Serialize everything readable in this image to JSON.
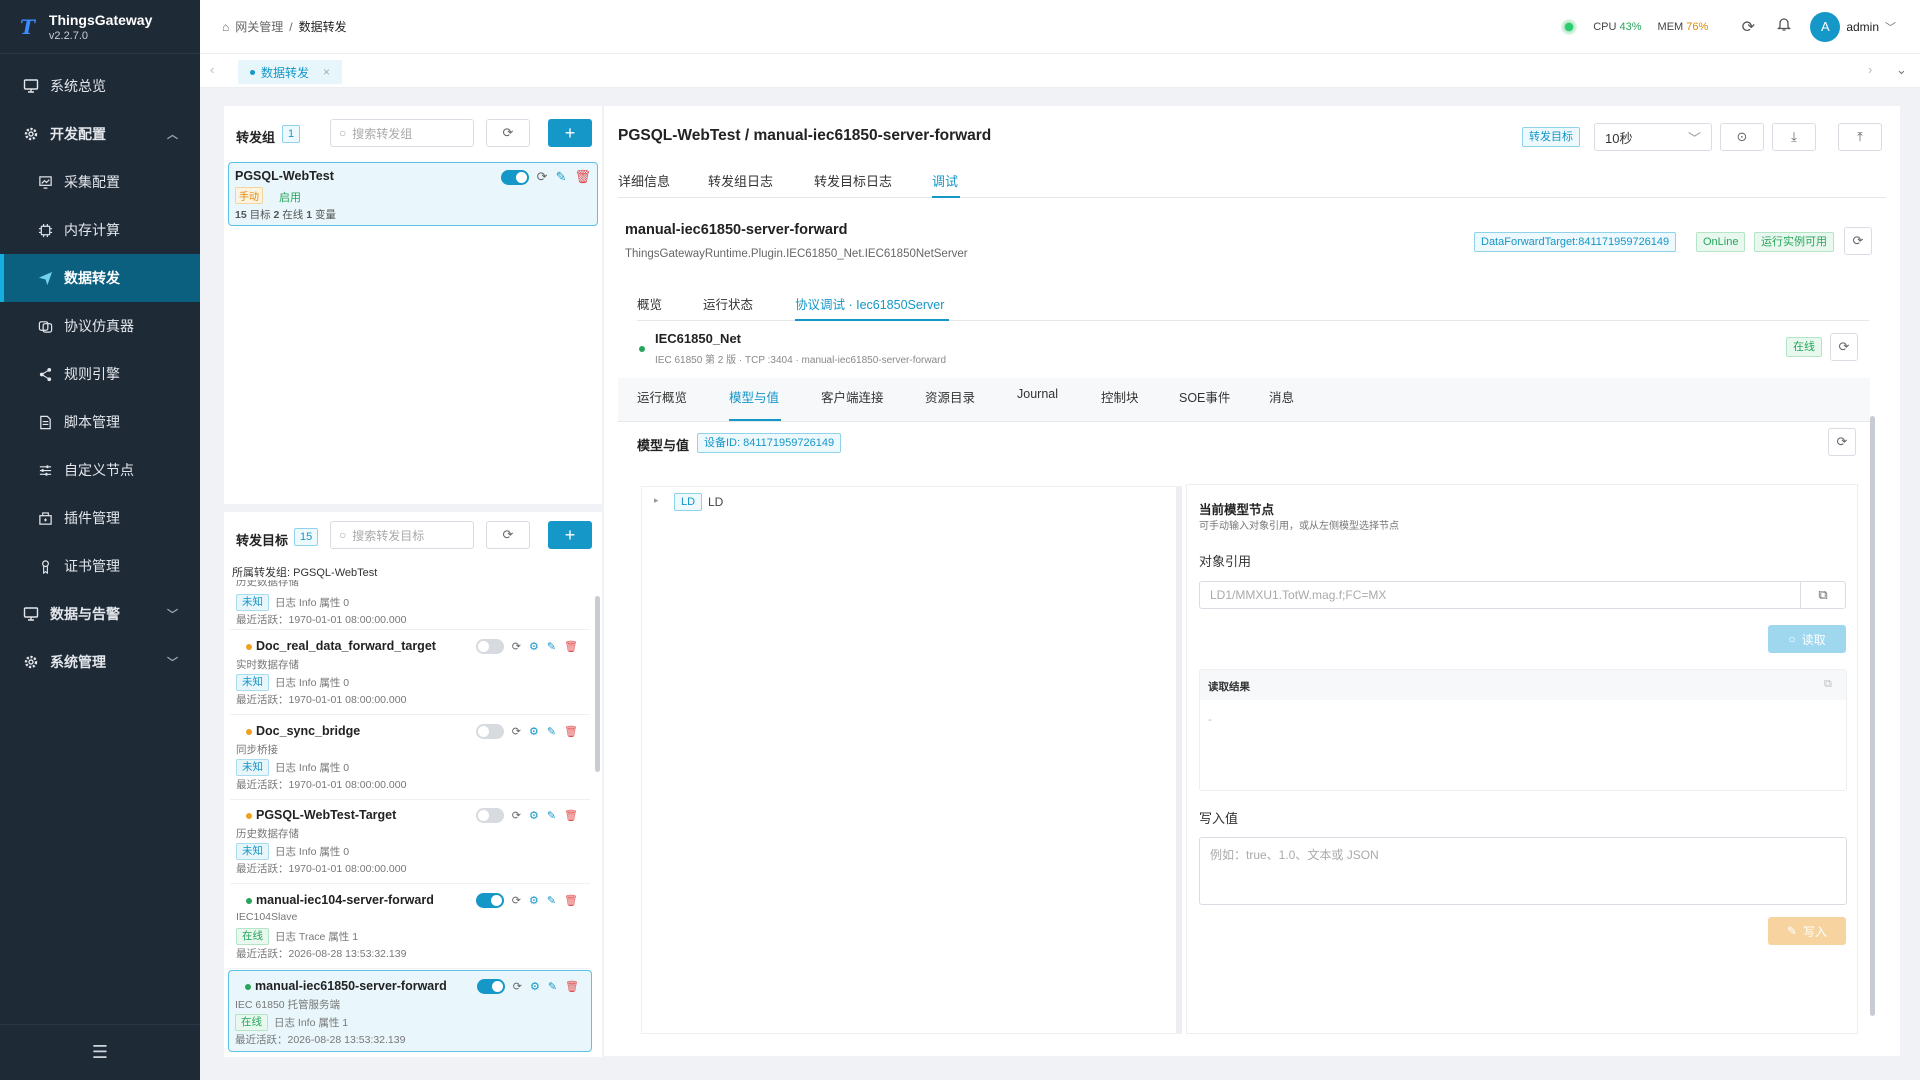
{
  "app": {
    "name": "ThingsGateway",
    "version": "v2.2.7.0"
  },
  "sidebar": {
    "items": [
      {
        "label": "系统总览",
        "icon": "monitor-icon"
      },
      {
        "label": "开发配置",
        "icon": "gear-icon"
      },
      {
        "label": "采集配置",
        "icon": "collect-icon"
      },
      {
        "label": "内存计算",
        "icon": "chip-icon"
      },
      {
        "label": "数据转发",
        "icon": "send-icon"
      },
      {
        "label": "协议仿真器",
        "icon": "simulator-icon"
      },
      {
        "label": "规则引擎",
        "icon": "share-icon"
      },
      {
        "label": "脚本管理",
        "icon": "file-icon"
      },
      {
        "label": "自定义节点",
        "icon": "sliders-icon"
      },
      {
        "label": "插件管理",
        "icon": "plugin-icon"
      },
      {
        "label": "证书管理",
        "icon": "certificate-icon"
      },
      {
        "label": "数据与告警",
        "icon": "monitor-icon"
      },
      {
        "label": "系统管理",
        "icon": "gear-icon"
      }
    ]
  },
  "header": {
    "breadcrumb_root": "网关管理",
    "breadcrumb_sep": "/",
    "breadcrumb_current": "数据转发",
    "cpu_label": "CPU",
    "cpu_value": "43%",
    "mem_label": "MEM",
    "mem_value": "76%",
    "avatar_letter": "A",
    "user": "admin"
  },
  "tabs": {
    "page_tab": "数据转发"
  },
  "groups": {
    "title": "转发组",
    "count": "1",
    "search_placeholder": "搜索转发组",
    "card": {
      "name": "PGSQL-WebTest",
      "mode": "手动",
      "status": "启用",
      "n_targets": "15",
      "targets_label": "目标",
      "n_online": "2",
      "online_label": "在线",
      "n_vars": "1",
      "vars_label": "变量"
    }
  },
  "targets": {
    "title": "转发目标",
    "count": "15",
    "search_placeholder": "搜索转发目标",
    "group_label": "所属转发组:",
    "group_value": "PGSQL-WebTest",
    "partial": {
      "sub": "历史数据存储",
      "state": "未知",
      "log": "日志 Info 属性 0",
      "last": "最近活跃：1970-01-01 08:00:00.000"
    },
    "items": [
      {
        "name": "Doc_real_data_forward_target",
        "sub": "实时数据存储",
        "state": "未知",
        "log": "日志 Info 属性 0",
        "last": "最近活跃：1970-01-01 08:00:00.000",
        "enabled": false,
        "dot": "#f0a020"
      },
      {
        "name": "Doc_sync_bridge",
        "sub": "同步桥接",
        "state": "未知",
        "log": "日志 Info 属性 0",
        "last": "最近活跃：1970-01-01 08:00:00.000",
        "enabled": false,
        "dot": "#f0a020"
      },
      {
        "name": "PGSQL-WebTest-Target",
        "sub": "历史数据存储",
        "state": "未知",
        "log": "日志 Info 属性 0",
        "last": "最近活跃：1970-01-01 08:00:00.000",
        "enabled": false,
        "dot": "#f0a020"
      },
      {
        "name": "manual-iec104-server-forward",
        "sub": "IEC104Slave",
        "state": "在线",
        "log": "日志 Trace 属性 1",
        "last": "最近活跃：2026-08-28 13:53:32.139",
        "enabled": true,
        "dot": "#27a55a"
      },
      {
        "name": "manual-iec61850-server-forward",
        "sub": "IEC 61850 托管服务端",
        "state": "在线",
        "log": "日志 Info 属性 1",
        "last": "最近活跃：2026-08-28 13:53:32.139",
        "enabled": true,
        "dot": "#27a55a"
      }
    ]
  },
  "detail": {
    "title": "PGSQL-WebTest / manual-iec61850-server-forward",
    "target_badge": "转发目标",
    "interval": "10秒",
    "tabs": [
      "详细信息",
      "转发组日志",
      "转发目标日志",
      "调试"
    ],
    "plugin_name": "manual-iec61850-server-forward",
    "plugin_class": "ThingsGatewayRuntime.Plugin.IEC61850_Net.IEC61850NetServer",
    "id_badge": "DataForwardTarget:841171959726149",
    "online_badge": "OnLine",
    "available_badge": "运行实例可用",
    "subtabs": [
      "概览",
      "运行状态",
      "协议调试 · Iec61850Server"
    ],
    "server": {
      "name": "IEC61850_Net",
      "info": "IEC 61850 第 2 版 · TCP :3404 · manual-iec61850-server-forward",
      "status": "在线"
    },
    "proto_tabs": [
      "运行概览",
      "模型与值",
      "客户端连接",
      "资源目录",
      "Journal",
      "控制块",
      "SOE事件",
      "消息"
    ],
    "model": {
      "title": "模型与值",
      "device_id": "设备ID: 841171959726149",
      "tree_badge": "LD",
      "tree_label": "LD",
      "node_title": "当前模型节点",
      "node_hint": "可手动输入对象引用，或从左侧模型选择节点",
      "ref_label": "对象引用",
      "ref_placeholder": "LD1/MMXU1.TotW.mag.f;FC=MX",
      "read_btn": "读取",
      "result_label": "读取结果",
      "result_value": "-",
      "write_label": "写入值",
      "write_placeholder": "例如：true、1.0、文本或 JSON",
      "write_btn": "写入"
    }
  },
  "colors": {
    "accent": "#1597c8",
    "sidebar": "#1f2a37",
    "online": "#27a55a",
    "warn": "#f0a020"
  }
}
